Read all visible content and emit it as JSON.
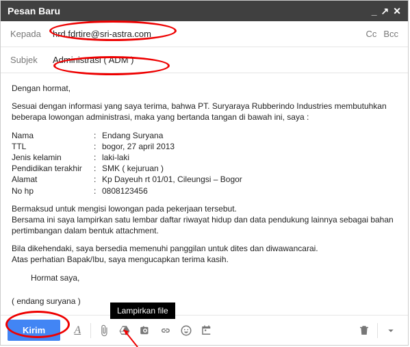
{
  "titlebar": {
    "title": "Pesan Baru"
  },
  "to": {
    "label": "Kepada",
    "value": "hrd.fdrtire@sri-astra.com",
    "cc": "Cc",
    "bcc": "Bcc"
  },
  "subject": {
    "label": "Subjek",
    "value": "Administrasi ( ADM )"
  },
  "body": {
    "greeting": "Dengan hormat,",
    "intro": "Sesuai dengan informasi yang saya terima, bahwa PT. Suryaraya Rubberindo Industries membutuhkan beberapa lowongan administrasi, maka yang bertanda tangan di bawah ini, saya :",
    "details": [
      {
        "label": "Nama",
        "value": "Endang Suryana"
      },
      {
        "label": "TTL",
        "value": "bogor, 27 april 2013"
      },
      {
        "label": "Jenis kelamin",
        "value": "laki-laki"
      },
      {
        "label": "Pendidikan terakhir",
        "value": "SMK ( kejuruan )"
      },
      {
        "label": "Alamat",
        "value": "Kp Dayeuh rt 01/01, Cileungsi – Bogor"
      },
      {
        "label": "No hp",
        "value": "0808123456"
      }
    ],
    "para1": "Bermaksud untuk mengisi lowongan pada pekerjaan tersebut.",
    "para2": "Bersama ini saya lampirkan satu lembar daftar riwayat hidup dan data pendukung lainnya sebagai bahan pertimbangan dalam bentuk attachment.",
    "para3": "Bila dikehendaki, saya bersedia memenuhi panggilan untuk dites dan diwawancarai.",
    "para4": "Atas perhatian Bapak/Ibu, saya mengucapkan terima kasih.",
    "closing": "Hormat saya,",
    "signature": "( endang suryana )"
  },
  "toolbar": {
    "send": "Kirim",
    "tooltip": "Lampirkan file"
  }
}
